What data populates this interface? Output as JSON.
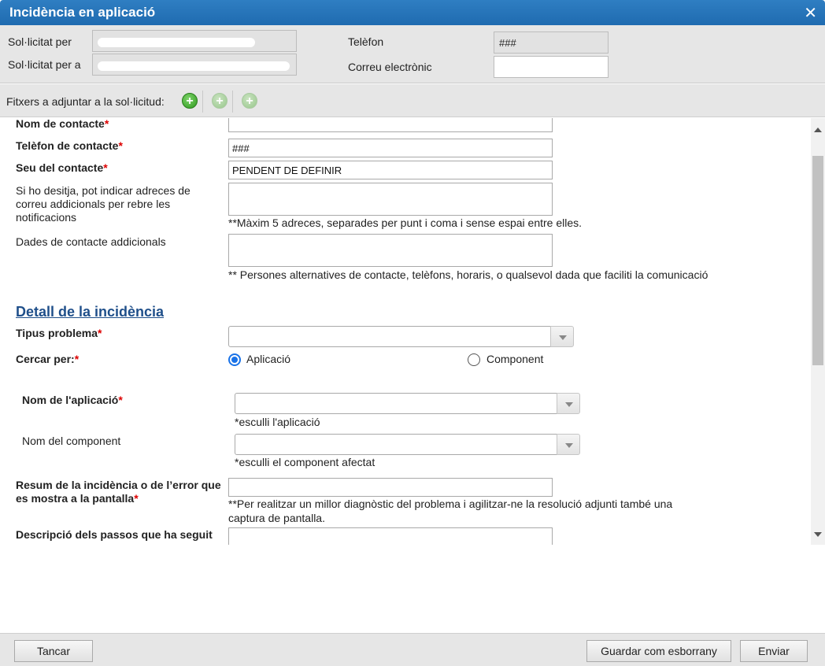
{
  "window": {
    "title": "Incidència en aplicació",
    "close_glyph": "✕"
  },
  "header": {
    "requested_by_label": "Sol·licitat per",
    "requested_for_label": "Sol·licitat per a",
    "phone_label": "Telèfon",
    "phone_value": "###",
    "email_label": "Correu electrònic"
  },
  "attachments": {
    "label": "Fitxers a adjuntar a la sol·licitud:",
    "icons": [
      "add-circle-icon",
      "add-circle-disabled-icon",
      "add-circle-disabled-icon"
    ]
  },
  "form": {
    "contact_name_label": "Nom de contacte",
    "contact_phone_label": "Telèfon de contacte",
    "contact_phone_value": "###",
    "contact_site_label": "Seu del contacte",
    "contact_site_value": "PENDENT DE DEFINIR",
    "extra_emails_label": "Si ho desitja, pot indicar adreces de correu addicionals per rebre les notificacions",
    "extra_emails_hint": "**Màxim 5 adreces, separades per punt i coma i sense espai entre elles.",
    "extra_contact_label": "Dades de contacte addicionals",
    "extra_contact_hint": "** Persones alternatives de contacte, telèfons, horaris, o qualsevol dada que faciliti la comunicació",
    "detail_section_title": "Detall de la incidència",
    "problem_type_label": "Tipus problema",
    "search_by_label": "Cercar per:",
    "radio_app_label": "Aplicació",
    "radio_component_label": "Component",
    "app_name_label": "Nom de l'aplicació",
    "app_name_hint": "*esculli l'aplicació",
    "component_name_label": "Nom del component",
    "component_name_hint": "*esculli el component afectat",
    "summary_label": "Resum de la incidència o de l’error que es mostra a la pantalla",
    "summary_hint": "**Per realitzar un millor diagnòstic del problema i agilitzar-ne la resolució adjunti també una captura de pantalla.",
    "steps_label": "Descripció dels passos que ha seguit"
  },
  "footer": {
    "close_label": "Tancar",
    "draft_label": "Guardar com esborrany",
    "send_label": "Enviar"
  },
  "colors": {
    "titlebar": "#1f6bb0",
    "required": "#dd0000",
    "section": "#1f4f8a"
  }
}
